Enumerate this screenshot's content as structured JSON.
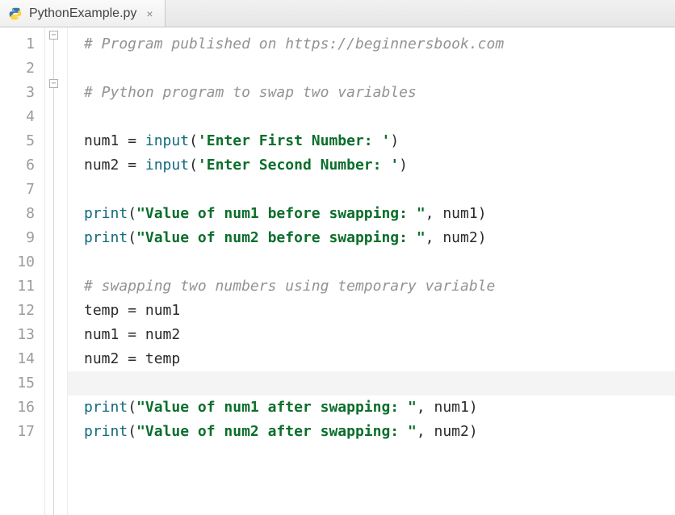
{
  "tab": {
    "filename": "PythonExample.py",
    "close_glyph": "×"
  },
  "gutter": [
    "1",
    "2",
    "3",
    "4",
    "5",
    "6",
    "7",
    "8",
    "9",
    "10",
    "11",
    "12",
    "13",
    "14",
    "15",
    "16",
    "17"
  ],
  "fold_boxes": [
    {
      "line": 1,
      "glyph": "−"
    },
    {
      "line": 3,
      "glyph": "−"
    }
  ],
  "highlighted_line": 15,
  "code": {
    "l1": {
      "comment": "# Program published on https://beginnersbook.com"
    },
    "l3": {
      "comment": "# Python program to swap two variables"
    },
    "l5": {
      "var": "num1",
      "eq": " = ",
      "fn": "input",
      "lp": "(",
      "str": "'Enter First Number: '",
      "rp": ")"
    },
    "l6": {
      "var": "num2",
      "eq": " = ",
      "fn": "input",
      "lp": "(",
      "str": "'Enter Second Number: '",
      "rp": ")"
    },
    "l8": {
      "fn": "print",
      "lp": "(",
      "str": "\"Value of num1 before swapping: \"",
      "comma": ", ",
      "arg": "num1",
      "rp": ")"
    },
    "l9": {
      "fn": "print",
      "lp": "(",
      "str": "\"Value of num2 before swapping: \"",
      "comma": ", ",
      "arg": "num2",
      "rp": ")"
    },
    "l11": {
      "comment": "# swapping two numbers using temporary variable"
    },
    "l12": {
      "lhs": "temp",
      "eq": " = ",
      "rhs": "num1"
    },
    "l13": {
      "lhs": "num1",
      "eq": " = ",
      "rhs": "num2"
    },
    "l14": {
      "lhs": "num2",
      "eq": " = ",
      "rhs": "temp"
    },
    "l16": {
      "fn": "print",
      "lp": "(",
      "str": "\"Value of num1 after swapping: \"",
      "comma": ", ",
      "arg": "num1",
      "rp": ")"
    },
    "l17": {
      "fn": "print",
      "lp": "(",
      "str": "\"Value of num2 after swapping: \"",
      "comma": ", ",
      "arg": "num2",
      "rp": ")"
    }
  }
}
